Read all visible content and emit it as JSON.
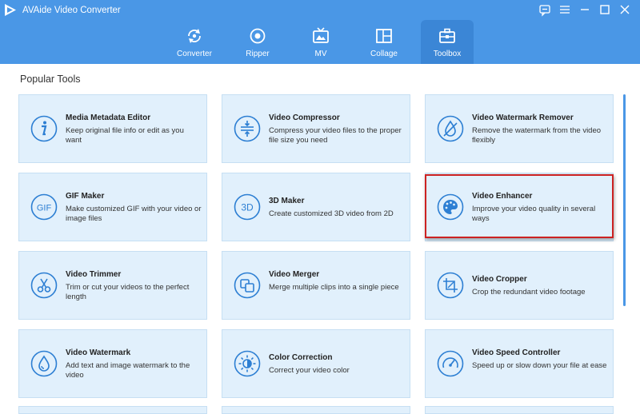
{
  "app": {
    "title": "AVAide Video Converter"
  },
  "nav": [
    {
      "label": "Converter",
      "icon": "converter-icon"
    },
    {
      "label": "Ripper",
      "icon": "ripper-icon"
    },
    {
      "label": "MV",
      "icon": "mv-icon"
    },
    {
      "label": "Collage",
      "icon": "collage-icon"
    },
    {
      "label": "Toolbox",
      "icon": "toolbox-icon",
      "active": true
    }
  ],
  "section_title": "Popular Tools",
  "tools": [
    {
      "title": "Media Metadata Editor",
      "desc": "Keep original file info or edit as you want",
      "icon": "info-icon"
    },
    {
      "title": "Video Compressor",
      "desc": "Compress your video files to the proper file size you need",
      "icon": "compress-icon"
    },
    {
      "title": "Video Watermark Remover",
      "desc": "Remove the watermark from the video flexibly",
      "icon": "watermark-remove-icon"
    },
    {
      "title": "GIF Maker",
      "desc": "Make customized GIF with your video or image files",
      "icon": "gif-icon"
    },
    {
      "title": "3D Maker",
      "desc": "Create customized 3D video from 2D",
      "icon": "3d-icon"
    },
    {
      "title": "Video Enhancer",
      "desc": "Improve your video quality in several ways",
      "icon": "palette-icon",
      "highlighted": true
    },
    {
      "title": "Video Trimmer",
      "desc": "Trim or cut your videos to the perfect length",
      "icon": "scissors-icon"
    },
    {
      "title": "Video Merger",
      "desc": "Merge multiple clips into a single piece",
      "icon": "merge-icon"
    },
    {
      "title": "Video Cropper",
      "desc": "Crop the redundant video footage",
      "icon": "crop-icon"
    },
    {
      "title": "Video Watermark",
      "desc": "Add text and image watermark to the video",
      "icon": "drop-icon"
    },
    {
      "title": "Color Correction",
      "desc": "Correct your video color",
      "icon": "sun-icon"
    },
    {
      "title": "Video Speed Controller",
      "desc": "Speed up or slow down your file at ease",
      "icon": "speed-icon"
    }
  ],
  "colors": {
    "header": "#4a97e6",
    "card_bg": "#e1f0fc",
    "icon_blue": "#2d7fd3",
    "highlight": "#cc2222"
  }
}
